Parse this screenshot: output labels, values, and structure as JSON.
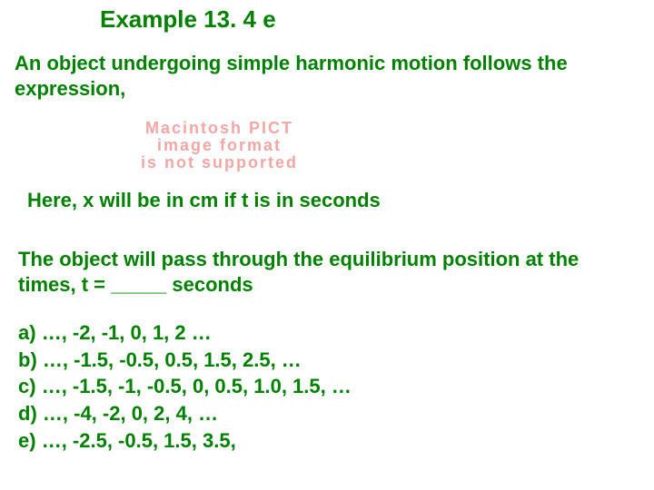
{
  "title": "Example 13. 4 e",
  "intro": "An object undergoing simple harmonic motion follows the expression,",
  "pict": {
    "l1": "Macintosh PICT",
    "l2": "image format",
    "l3": "is not supported"
  },
  "note": "Here, x will be in cm if t is in seconds",
  "question": "The object will pass through the equilibrium position at the times, t = _____ seconds",
  "options": [
    {
      "label": "a)",
      "text": "…, -2, -1, 0, 1, 2 …"
    },
    {
      "label": "b)",
      "text": "…, -1.5, -0.5, 0.5, 1.5, 2.5, …"
    },
    {
      "label": "c)",
      "text": "…, -1.5, -1, -0.5, 0, 0.5, 1.0, 1.5, …"
    },
    {
      "label": "d)",
      "text": "…, -4, -2, 0, 2, 4, …"
    },
    {
      "label": "e)",
      "text": "…, -2.5, -0.5, 1.5, 3.5,"
    }
  ]
}
